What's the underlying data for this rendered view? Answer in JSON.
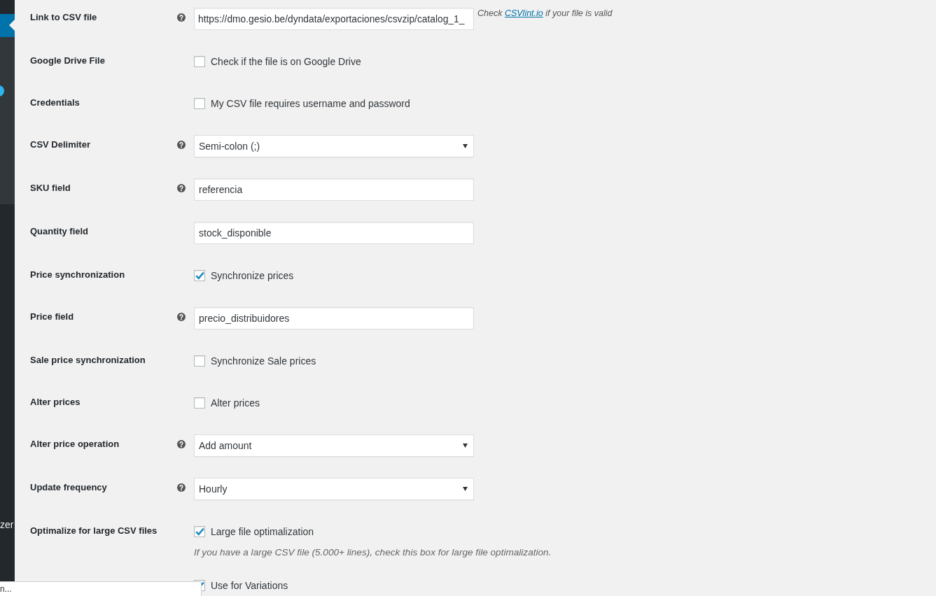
{
  "sidebar": {
    "items": [
      {
        "selected": true
      },
      {
        "label": "zer",
        "selected": false
      }
    ],
    "badge_dot": true
  },
  "settings": [
    {
      "kind": "text",
      "label": "Link to CSV file",
      "help": true,
      "value": "https://dmo.gesio.be/dyndata/exportaciones/csvzip/catalog_1_",
      "note": {
        "before": "Check",
        "link": "CSVlint.io",
        "after": "if your file is valid"
      }
    },
    {
      "kind": "checkbox",
      "label": "Google Drive File",
      "help": false,
      "checked": false,
      "option": "Check if the file is on Google Drive"
    },
    {
      "kind": "checkbox",
      "label": "Credentials",
      "help": false,
      "checked": false,
      "option": "My CSV file requires username and password"
    },
    {
      "kind": "select",
      "label": "CSV Delimiter",
      "help": true,
      "value": "Semi-colon (;)"
    },
    {
      "kind": "text",
      "label": "SKU field",
      "help": true,
      "value": "referencia"
    },
    {
      "kind": "text",
      "label": "Quantity field",
      "help": false,
      "value": "stock_disponible"
    },
    {
      "kind": "checkbox",
      "label": "Price synchronization",
      "help": false,
      "checked": true,
      "option": "Synchronize prices"
    },
    {
      "kind": "text",
      "label": "Price field",
      "help": true,
      "value": "precio_distribuidores"
    },
    {
      "kind": "checkbox",
      "label": "Sale price synchronization",
      "help": false,
      "checked": false,
      "option": "Synchronize Sale prices"
    },
    {
      "kind": "checkbox",
      "label": "Alter prices",
      "help": false,
      "checked": false,
      "option": "Alter prices"
    },
    {
      "kind": "select",
      "label": "Alter price operation",
      "help": true,
      "value": "Add amount"
    },
    {
      "kind": "select",
      "label": "Update frequency",
      "help": true,
      "value": "Hourly"
    },
    {
      "kind": "checkbox",
      "label": "Optimalize for large CSV files",
      "help": false,
      "checked": true,
      "option": "Large file optimalization",
      "description": "If you have a large CSV file (5.000+ lines), check this box for large file optimalization."
    },
    {
      "kind": "checkbox",
      "help": false,
      "checked": true,
      "option": "Use for Variations"
    }
  ],
  "status_bubble": {
    "text": "n..."
  }
}
